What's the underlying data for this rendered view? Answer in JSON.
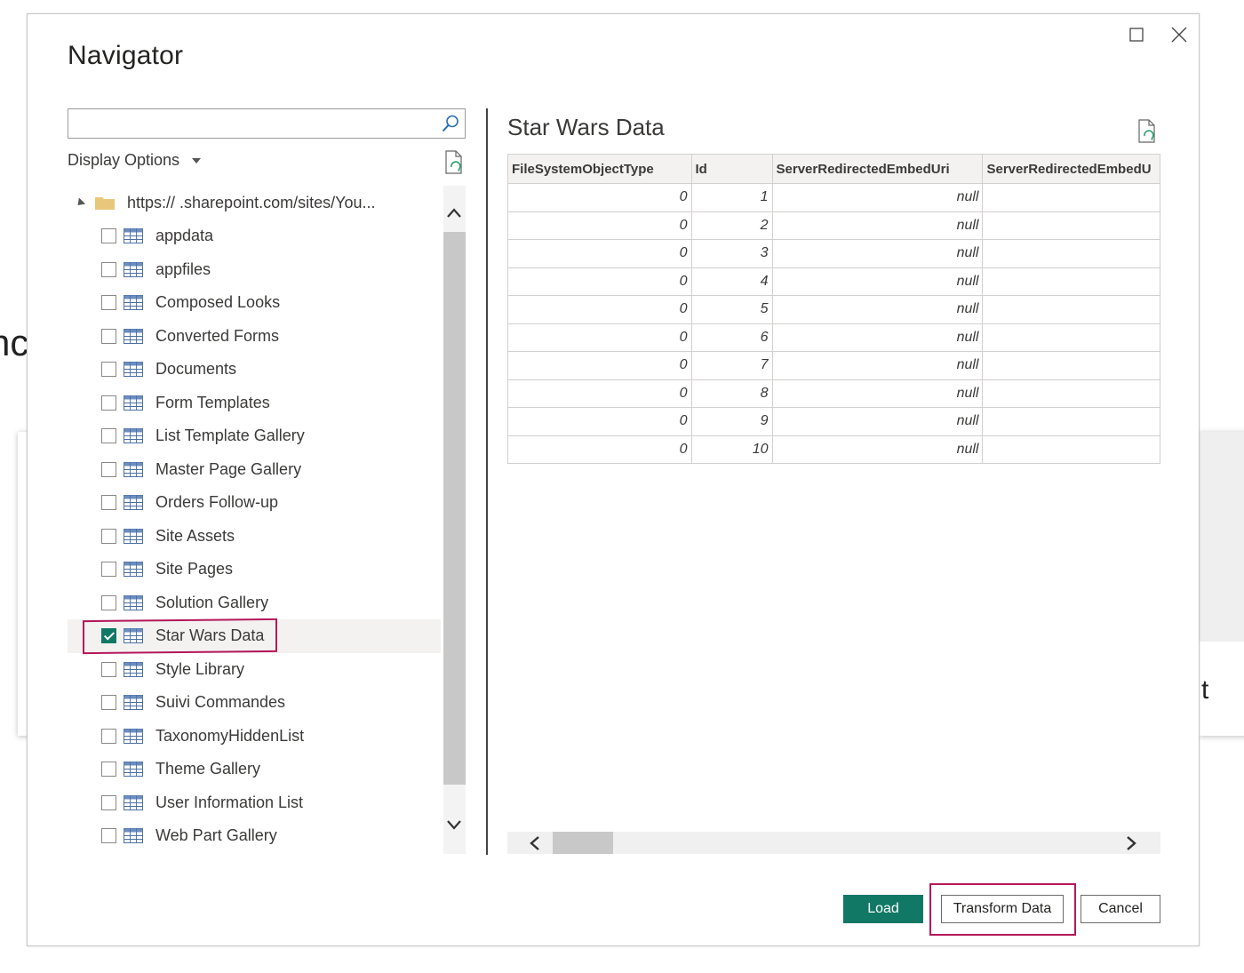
{
  "background": {
    "left_text": "nc",
    "right_text": "t"
  },
  "dialog": {
    "title": "Navigator",
    "search": {
      "value": "",
      "placeholder": ""
    },
    "display_options": "Display Options",
    "tree": {
      "root_label": "https://          .sharepoint.com/sites/You...",
      "items": [
        {
          "label": "appdata",
          "checked": false
        },
        {
          "label": "appfiles",
          "checked": false
        },
        {
          "label": "Composed Looks",
          "checked": false
        },
        {
          "label": "Converted Forms",
          "checked": false
        },
        {
          "label": "Documents",
          "checked": false
        },
        {
          "label": "Form Templates",
          "checked": false
        },
        {
          "label": "List Template Gallery",
          "checked": false
        },
        {
          "label": "Master Page Gallery",
          "checked": false
        },
        {
          "label": "Orders Follow-up",
          "checked": false
        },
        {
          "label": "Site Assets",
          "checked": false
        },
        {
          "label": "Site Pages",
          "checked": false
        },
        {
          "label": "Solution Gallery",
          "checked": false
        },
        {
          "label": "Star Wars Data",
          "checked": true
        },
        {
          "label": "Style Library",
          "checked": false
        },
        {
          "label": "Suivi Commandes",
          "checked": false
        },
        {
          "label": "TaxonomyHiddenList",
          "checked": false
        },
        {
          "label": "Theme Gallery",
          "checked": false
        },
        {
          "label": "User Information List",
          "checked": false
        },
        {
          "label": "Web Part Gallery",
          "checked": false
        }
      ]
    },
    "preview": {
      "title": "Star Wars Data",
      "columns": [
        "FileSystemObjectType",
        "Id",
        "ServerRedirectedEmbedUri",
        "ServerRedirectedEmbedU"
      ],
      "rows": [
        [
          "0",
          "1",
          "null",
          ""
        ],
        [
          "0",
          "2",
          "null",
          ""
        ],
        [
          "0",
          "3",
          "null",
          ""
        ],
        [
          "0",
          "4",
          "null",
          ""
        ],
        [
          "0",
          "5",
          "null",
          ""
        ],
        [
          "0",
          "6",
          "null",
          ""
        ],
        [
          "0",
          "7",
          "null",
          ""
        ],
        [
          "0",
          "8",
          "null",
          ""
        ],
        [
          "0",
          "9",
          "null",
          ""
        ],
        [
          "0",
          "10",
          "null",
          ""
        ]
      ]
    },
    "buttons": {
      "load": "Load",
      "transform": "Transform Data",
      "cancel": "Cancel"
    }
  },
  "colors": {
    "accent": "#117865",
    "highlight": "#b5175a"
  }
}
